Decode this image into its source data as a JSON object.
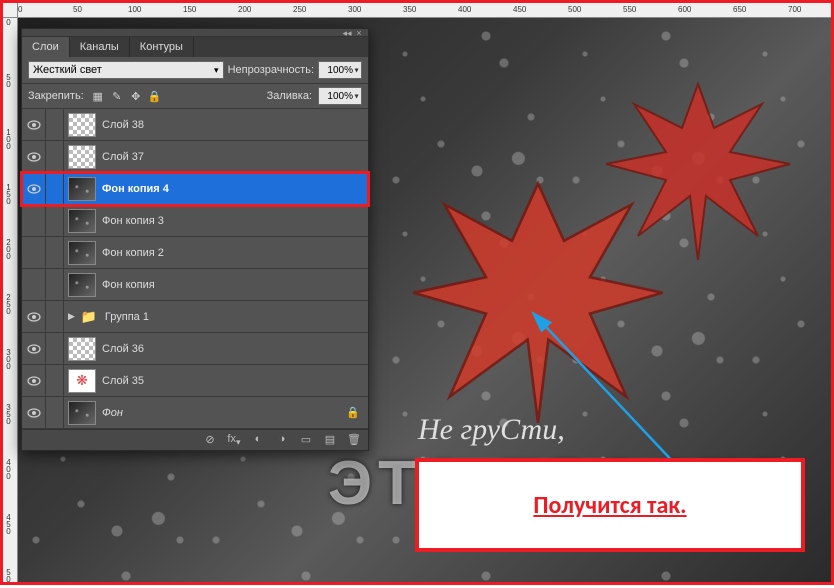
{
  "rulers": {
    "h_ticks": [
      "0",
      "50",
      "100",
      "150",
      "200",
      "250",
      "300",
      "350",
      "400",
      "450",
      "500",
      "550",
      "600",
      "650",
      "700"
    ],
    "v_ticks": [
      "0",
      "50",
      "100",
      "150",
      "200",
      "250",
      "300",
      "350",
      "400",
      "450",
      "500"
    ]
  },
  "panel": {
    "tabs": [
      {
        "label": "Слои",
        "active": true
      },
      {
        "label": "Каналы",
        "active": false
      },
      {
        "label": "Контуры",
        "active": false
      }
    ],
    "blend_mode": "Жесткий свет",
    "opacity_label": "Непрозрачность:",
    "opacity_value": "100%",
    "lock_label": "Закрепить:",
    "fill_label": "Заливка:",
    "fill_value": "100%"
  },
  "layers": [
    {
      "name": "Слой 38",
      "visible": true,
      "thumb": "checker",
      "selected": false
    },
    {
      "name": "Слой 37",
      "visible": true,
      "thumb": "checker",
      "selected": false
    },
    {
      "name": "Фон копия 4",
      "visible": true,
      "thumb": "rain",
      "selected": true
    },
    {
      "name": "Фон копия 3",
      "visible": false,
      "thumb": "rain",
      "selected": false
    },
    {
      "name": "Фон копия 2",
      "visible": false,
      "thumb": "rain",
      "selected": false
    },
    {
      "name": "Фон копия",
      "visible": false,
      "thumb": "rain",
      "selected": false
    },
    {
      "name": "Группа 1",
      "visible": true,
      "group": true,
      "selected": false
    },
    {
      "name": "Слой 36",
      "visible": true,
      "thumb": "checker",
      "selected": false
    },
    {
      "name": "Слой 35",
      "visible": true,
      "thumb": "leaf",
      "selected": false
    },
    {
      "name": "Фон",
      "visible": true,
      "thumb": "rain",
      "locked": true,
      "italic": true,
      "selected": false
    }
  ],
  "canvas": {
    "script_text": "Не груСти,",
    "block_text": "ЭТО ПРОСТО"
  },
  "callout": {
    "text": "Получится так."
  },
  "colors": {
    "accent_red": "#ed1c24",
    "selection_blue": "#1e6fd9"
  }
}
